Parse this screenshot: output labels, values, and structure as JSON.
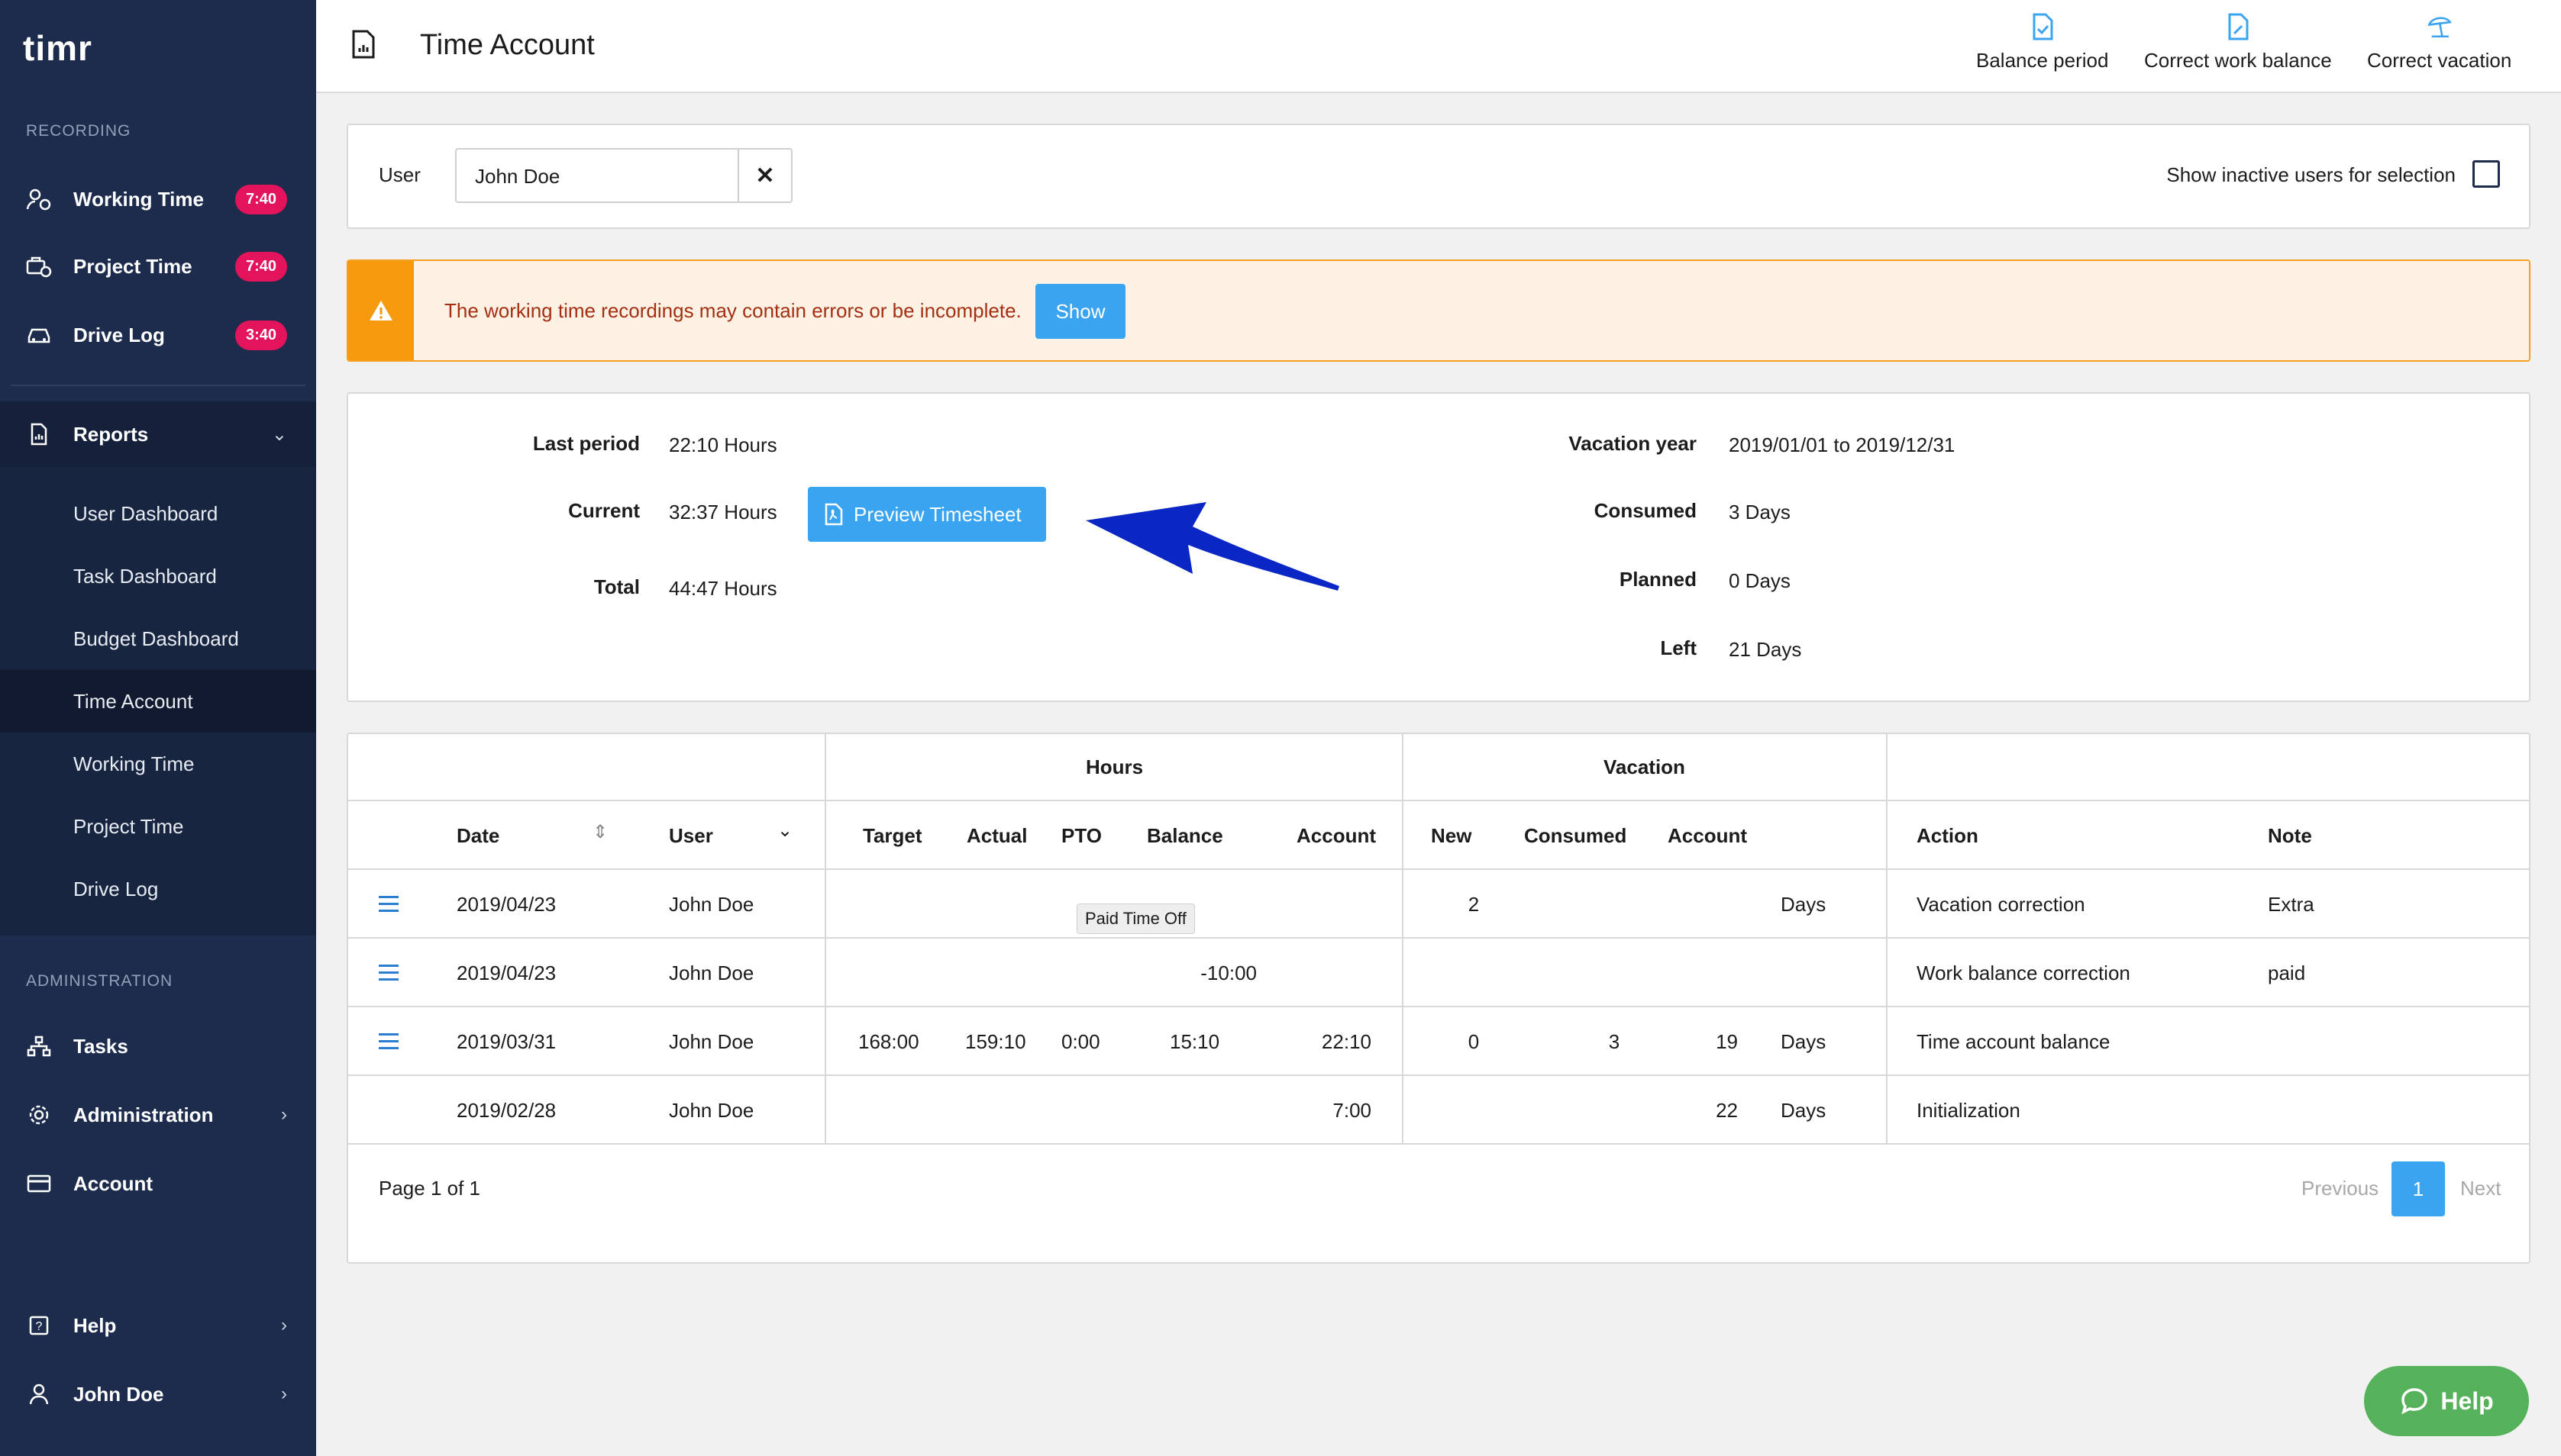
{
  "colors": {
    "sidebar": "#1d2c4d",
    "accent": "#3aa4f0",
    "badge": "#e3145c",
    "warning": "#f59a0c",
    "help": "#56b25a",
    "arrow": "#0a26c4"
  },
  "sidebar": {
    "logo": "timr",
    "recording_label": "RECORDING",
    "recording": [
      {
        "label": "Working Time",
        "badge": "7:40",
        "icon": "user-clock-icon"
      },
      {
        "label": "Project Time",
        "badge": "7:40",
        "icon": "briefcase-clock-icon"
      },
      {
        "label": "Drive Log",
        "badge": "3:40",
        "icon": "car-icon"
      }
    ],
    "reports": {
      "label": "Reports",
      "icon": "report-icon"
    },
    "report_items": [
      "User Dashboard",
      "Task Dashboard",
      "Budget Dashboard",
      "Time Account",
      "Working Time",
      "Project Time",
      "Drive Log"
    ],
    "active_report": "Time Account",
    "administration_label": "ADMINISTRATION",
    "admin_items": [
      {
        "label": "Tasks",
        "icon": "hierarchy-icon"
      },
      {
        "label": "Administration",
        "icon": "gear-icon"
      },
      {
        "label": "Account",
        "icon": "credit-card-icon"
      }
    ],
    "bottom_items": [
      {
        "label": "Help",
        "icon": "question-icon"
      },
      {
        "label": "John Doe",
        "icon": "user-icon"
      }
    ]
  },
  "header": {
    "title": "Time Account",
    "actions": [
      "Balance period",
      "Correct work balance",
      "Correct vacation"
    ]
  },
  "user_filter": {
    "label": "User",
    "value": "John Doe",
    "inactive_label": "Show inactive users for selection",
    "inactive_checked": false
  },
  "alert": {
    "message": "The working time recordings may contain errors or be incomplete.",
    "button": "Show"
  },
  "summary": {
    "last_period_label": "Last period",
    "last_period": "22:10 Hours",
    "current_label": "Current",
    "current": "32:37 Hours",
    "total_label": "Total",
    "total": "44:47 Hours",
    "preview_button": "Preview Timesheet",
    "vacation_year_label": "Vacation year",
    "vacation_year": "2019/01/01 to 2019/12/31",
    "consumed_label": "Consumed",
    "consumed": "3 Days",
    "planned_label": "Planned",
    "planned": "0 Days",
    "left_label": "Left",
    "left": "21 Days"
  },
  "table": {
    "groups": {
      "hours": "Hours",
      "vacation": "Vacation"
    },
    "columns": {
      "date": "Date",
      "user": "User",
      "target": "Target",
      "actual": "Actual",
      "pto": "PTO",
      "balance": "Balance",
      "account": "Account",
      "new": "New",
      "consumed": "Consumed",
      "vac_account": "Account",
      "action": "Action",
      "note": "Note"
    },
    "rows": [
      {
        "date": "2019/04/23",
        "user": "John Doe",
        "target": "",
        "actual": "",
        "pto": "",
        "balance": "",
        "account": "",
        "new": "2",
        "consumed": "",
        "vac_account": "",
        "unit": "Days",
        "action": "Vacation correction",
        "note": "Extra",
        "menu": true
      },
      {
        "date": "2019/04/23",
        "user": "John Doe",
        "target": "",
        "actual": "",
        "pto": "",
        "balance": "-10:00",
        "account": "",
        "new": "",
        "consumed": "",
        "vac_account": "",
        "unit": "",
        "action": "Work balance correction",
        "note": "paid",
        "menu": true
      },
      {
        "date": "2019/03/31",
        "user": "John Doe",
        "target": "168:00",
        "actual": "159:10",
        "pto": "0:00",
        "balance": "15:10",
        "account": "22:10",
        "new": "0",
        "consumed": "3",
        "vac_account": "19",
        "unit": "Days",
        "action": "Time account balance",
        "note": "",
        "menu": true
      },
      {
        "date": "2019/02/28",
        "user": "John Doe",
        "target": "",
        "actual": "",
        "pto": "",
        "balance": "",
        "account": "7:00",
        "new": "",
        "consumed": "",
        "vac_account": "22",
        "unit": "Days",
        "action": "Initialization",
        "note": "",
        "menu": false
      }
    ],
    "tooltip": "Paid Time Off"
  },
  "pager": {
    "text": "Page 1 of 1",
    "previous": "Previous",
    "current": "1",
    "next": "Next"
  },
  "help_button": "Help"
}
